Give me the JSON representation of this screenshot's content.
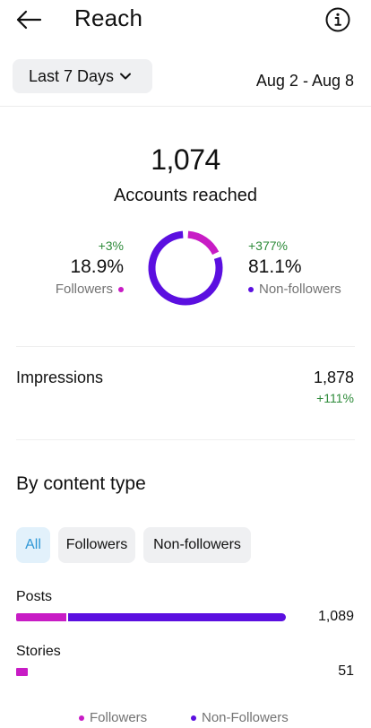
{
  "header": {
    "title": "Reach"
  },
  "filters": {
    "range_label": "Last 7 Days",
    "date_range": "Aug 2 - Aug 8"
  },
  "summary": {
    "accounts_reached": "1,074",
    "accounts_reached_label": "Accounts reached",
    "followers": {
      "delta": "+3%",
      "percent": "18.9%",
      "label": "Followers",
      "share": 0.189
    },
    "non_followers": {
      "delta": "+377%",
      "percent": "81.1%",
      "label": "Non-followers",
      "share": 0.811
    }
  },
  "impressions": {
    "label": "Impressions",
    "value": "1,878",
    "delta": "+111%"
  },
  "content_type": {
    "title": "By content type",
    "tabs": [
      "All",
      "Followers",
      "Non-followers"
    ],
    "active_tab": "All",
    "rows": [
      {
        "label": "Posts",
        "value": "1,089",
        "followers_share": 0.19,
        "non_followers_share": 0.81,
        "relative_total": 1.0
      },
      {
        "label": "Stories",
        "value": "51",
        "followers_share": 1.0,
        "non_followers_share": 0.0,
        "relative_total": 0.047
      }
    ],
    "legend": {
      "followers": "Followers",
      "non_followers": "Non-Followers"
    }
  },
  "colors": {
    "followers": "#c81cc5",
    "non_followers": "#5b0fe0",
    "positive": "#2e8b3a",
    "active_chip_text": "#2f97d6",
    "active_chip_bg": "#e2f1fb"
  },
  "icons": {
    "back": "arrow-left-icon",
    "info": "info-circle-icon",
    "dropdown": "chevron-down-icon"
  }
}
